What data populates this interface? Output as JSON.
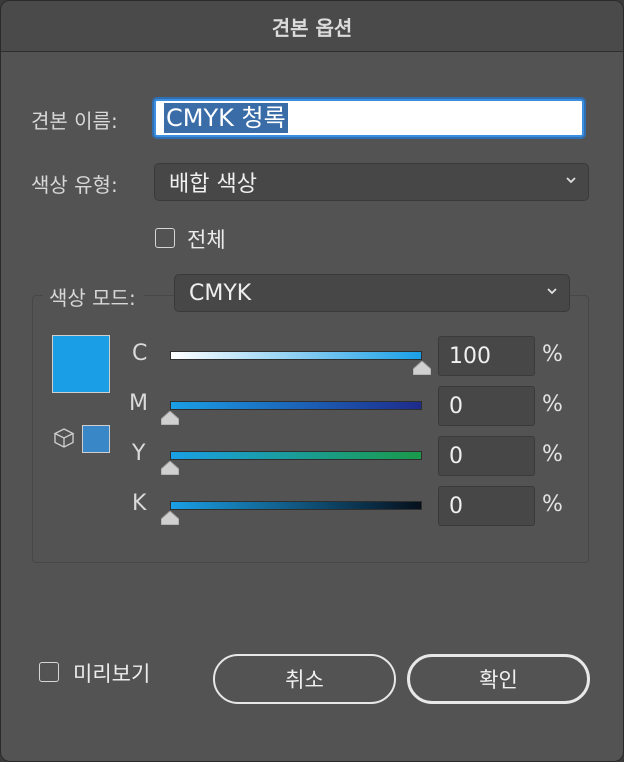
{
  "dialog": {
    "title": "견본 옵션",
    "swatch_name_label": "견본 이름:",
    "swatch_name_value": "CMYK 청록",
    "color_type_label": "색상 유형:",
    "color_type_value": "배합 색상",
    "global_label": "전체",
    "global_checked": false,
    "color_mode_label": "색상 모드:",
    "color_mode_value": "CMYK",
    "preview_label": "미리보기",
    "preview_checked": false,
    "cancel_label": "취소",
    "ok_label": "확인"
  },
  "color_preview": {
    "current_color": "#1A9FE6",
    "process_color": "#3A87C8"
  },
  "channels": [
    {
      "label": "C",
      "value": "100",
      "unit": "%",
      "fraction": 1.0
    },
    {
      "label": "M",
      "value": "0",
      "unit": "%",
      "fraction": 0.0
    },
    {
      "label": "Y",
      "value": "0",
      "unit": "%",
      "fraction": 0.0
    },
    {
      "label": "K",
      "value": "0",
      "unit": "%",
      "fraction": 0.0
    }
  ]
}
